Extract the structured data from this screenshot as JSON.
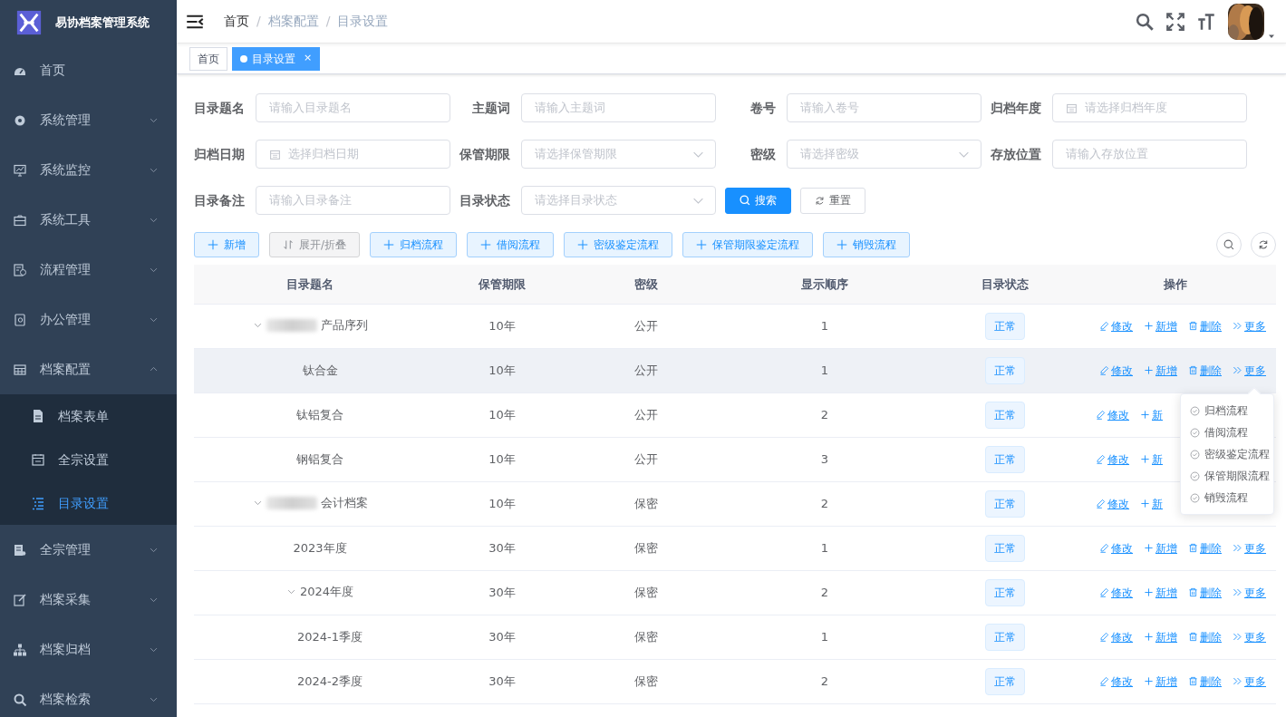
{
  "sidebar": {
    "logo_text": "易协档案管理系统",
    "items": [
      {
        "label": "首页"
      },
      {
        "label": "系统管理",
        "expanded": false
      },
      {
        "label": "系统监控",
        "expanded": false
      },
      {
        "label": "系统工具",
        "expanded": false
      },
      {
        "label": "流程管理",
        "expanded": false
      },
      {
        "label": "办公管理",
        "expanded": false
      },
      {
        "label": "档案配置",
        "expanded": true,
        "children": [
          {
            "label": "档案表单",
            "selected": false
          },
          {
            "label": "全宗设置",
            "selected": false
          },
          {
            "label": "目录设置",
            "selected": true
          }
        ]
      },
      {
        "label": "全宗管理",
        "expanded": false
      },
      {
        "label": "档案采集",
        "expanded": false
      },
      {
        "label": "档案归档",
        "expanded": false
      },
      {
        "label": "档案检索",
        "expanded": false
      }
    ]
  },
  "breadcrumb": [
    {
      "label": "首页",
      "link": true
    },
    {
      "label": "档案配置",
      "link": false,
      "separator": "/"
    },
    {
      "label": "目录设置",
      "link": false,
      "separator": "/"
    }
  ],
  "tags": [
    {
      "label": "首页",
      "selected": false
    },
    {
      "label": "目录设置",
      "selected": true,
      "closable": true,
      "close_text": "×"
    }
  ],
  "filters": [
    [
      {
        "label": "目录题名",
        "placeholder": "请输入目录题名",
        "kind": "text"
      },
      {
        "label": "主题词",
        "placeholder": "请输入主题词",
        "kind": "text"
      },
      {
        "label": "卷号",
        "placeholder": "请输入卷号",
        "kind": "text"
      },
      {
        "label": "归档年度",
        "placeholder": "请选择归档年度",
        "kind": "date"
      }
    ],
    [
      {
        "label": "归档日期",
        "placeholder": "选择归档日期",
        "kind": "date"
      },
      {
        "label": "保管期限",
        "placeholder": "请选择保管期限",
        "kind": "select"
      },
      {
        "label": "密级",
        "placeholder": "请选择密级",
        "kind": "select"
      },
      {
        "label": "存放位置",
        "placeholder": "请输入存放位置",
        "kind": "text"
      }
    ],
    [
      {
        "label": "目录备注",
        "placeholder": "请输入目录备注",
        "kind": "text"
      },
      {
        "label": "目录状态",
        "placeholder": "请选择目录状态",
        "kind": "select"
      }
    ]
  ],
  "search_buttons": [
    {
      "label": "搜索",
      "kind": "primary"
    },
    {
      "label": "重置",
      "kind": "default"
    }
  ],
  "toolbar": [
    {
      "label": "新增",
      "kind": "plus"
    },
    {
      "label": "展开/折叠",
      "kind": "toggle"
    },
    {
      "label": "归档流程",
      "kind": "plus"
    },
    {
      "label": "借阅流程",
      "kind": "plus"
    },
    {
      "label": "密级鉴定流程",
      "kind": "plus"
    },
    {
      "label": "保管期限鉴定流程",
      "kind": "plus"
    },
    {
      "label": "销毁流程",
      "kind": "plus"
    }
  ],
  "table": {
    "columns": [
      "目录题名",
      "保管期限",
      "密级",
      "显示顺序",
      "目录状态",
      "操作"
    ],
    "rows": [
      {
        "name": "产品序列",
        "redacted": true,
        "expanded": true,
        "period": "10年",
        "secret": "公开",
        "order": "1",
        "status": "正常",
        "highlighted": false,
        "actions": [
          "修改",
          "新增",
          "删除",
          "更多"
        ],
        "children": [
          {
            "name": "钛合金",
            "period": "10年",
            "secret": "公开",
            "order": "1",
            "status": "正常",
            "highlighted": true,
            "actions": [
              "修改",
              "新增",
              "删除",
              "更多"
            ]
          },
          {
            "name": "钛铝复合",
            "period": "10年",
            "secret": "公开",
            "order": "2",
            "status": "正常",
            "highlighted": false,
            "actions": [
              "修改",
              "新"
            ]
          },
          {
            "name": "钢铝复合",
            "period": "10年",
            "secret": "公开",
            "order": "3",
            "status": "正常",
            "highlighted": false,
            "actions": [
              "修改",
              "新"
            ]
          }
        ]
      },
      {
        "name": "会计档案",
        "redacted": true,
        "expanded": true,
        "period": "10年",
        "secret": "保密",
        "order": "2",
        "status": "正常",
        "highlighted": false,
        "actions": [
          "修改",
          "新"
        ],
        "children": [
          {
            "name": "2023年度",
            "period": "30年",
            "secret": "保密",
            "order": "1",
            "status": "正常",
            "highlighted": false,
            "actions": [
              "修改",
              "新增",
              "删除",
              "更多"
            ]
          },
          {
            "name": "2024年度",
            "expanded": true,
            "period": "30年",
            "secret": "保密",
            "order": "2",
            "status": "正常",
            "highlighted": false,
            "actions": [
              "修改",
              "新增",
              "删除",
              "更多"
            ],
            "children": [
              {
                "name": "2024-1季度",
                "period": "30年",
                "secret": "保密",
                "order": "1",
                "status": "正常",
                "highlighted": false,
                "actions": [
                  "修改",
                  "新增",
                  "删除",
                  "更多"
                ]
              },
              {
                "name": "2024-2季度",
                "period": "30年",
                "secret": "保密",
                "order": "2",
                "status": "正常",
                "highlighted": false,
                "actions": [
                  "修改",
                  "新增",
                  "删除",
                  "更多"
                ]
              }
            ]
          }
        ]
      }
    ]
  },
  "more_menu": {
    "items": [
      "归档流程",
      "借阅流程",
      "密级鉴定流程",
      "保管期限流程",
      "销毁流程"
    ]
  }
}
